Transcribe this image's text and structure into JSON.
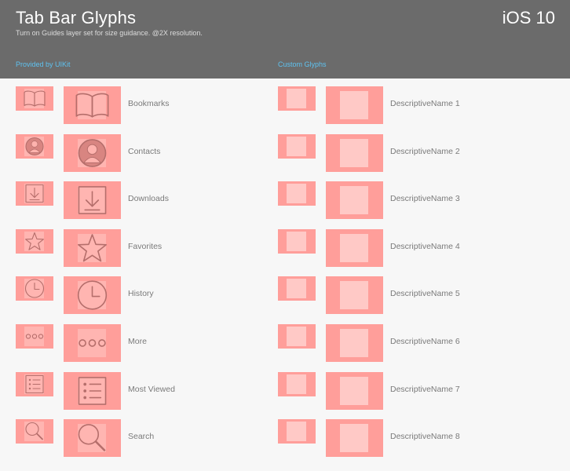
{
  "header": {
    "title": "Tab Bar Glyphs",
    "subtitle": "Turn on Guides layer set for size guidance. @2X resolution.",
    "platform": "iOS 10"
  },
  "sections": {
    "uikit_label": "Provided by UIKit",
    "custom_label": "Custom Glyphs"
  },
  "uikit_glyphs": [
    {
      "label": "Bookmarks",
      "icon": "bookmarks-icon"
    },
    {
      "label": "Contacts",
      "icon": "contacts-icon"
    },
    {
      "label": "Downloads",
      "icon": "downloads-icon"
    },
    {
      "label": "Favorites",
      "icon": "favorites-icon"
    },
    {
      "label": "History",
      "icon": "history-icon"
    },
    {
      "label": "More",
      "icon": "more-icon"
    },
    {
      "label": "Most Viewed",
      "icon": "most-viewed-icon"
    },
    {
      "label": "Search",
      "icon": "search-icon"
    }
  ],
  "custom_glyphs": [
    {
      "label": "DescriptiveName 1",
      "icon": "placeholder-icon"
    },
    {
      "label": "DescriptiveName 2",
      "icon": "placeholder-icon"
    },
    {
      "label": "DescriptiveName 3",
      "icon": "placeholder-icon"
    },
    {
      "label": "DescriptiveName 4",
      "icon": "placeholder-icon"
    },
    {
      "label": "DescriptiveName 5",
      "icon": "placeholder-icon"
    },
    {
      "label": "DescriptiveName 6",
      "icon": "placeholder-icon"
    },
    {
      "label": "DescriptiveName 7",
      "icon": "placeholder-icon"
    },
    {
      "label": "DescriptiveName 8",
      "icon": "placeholder-icon"
    }
  ],
  "colors": {
    "header_bg": "#6b6b6b",
    "tile": "#ff9e9a",
    "tile_inner": "#ffc9c6",
    "glyph_stroke": "#b56e6b",
    "section_label": "#5ec2f0"
  }
}
